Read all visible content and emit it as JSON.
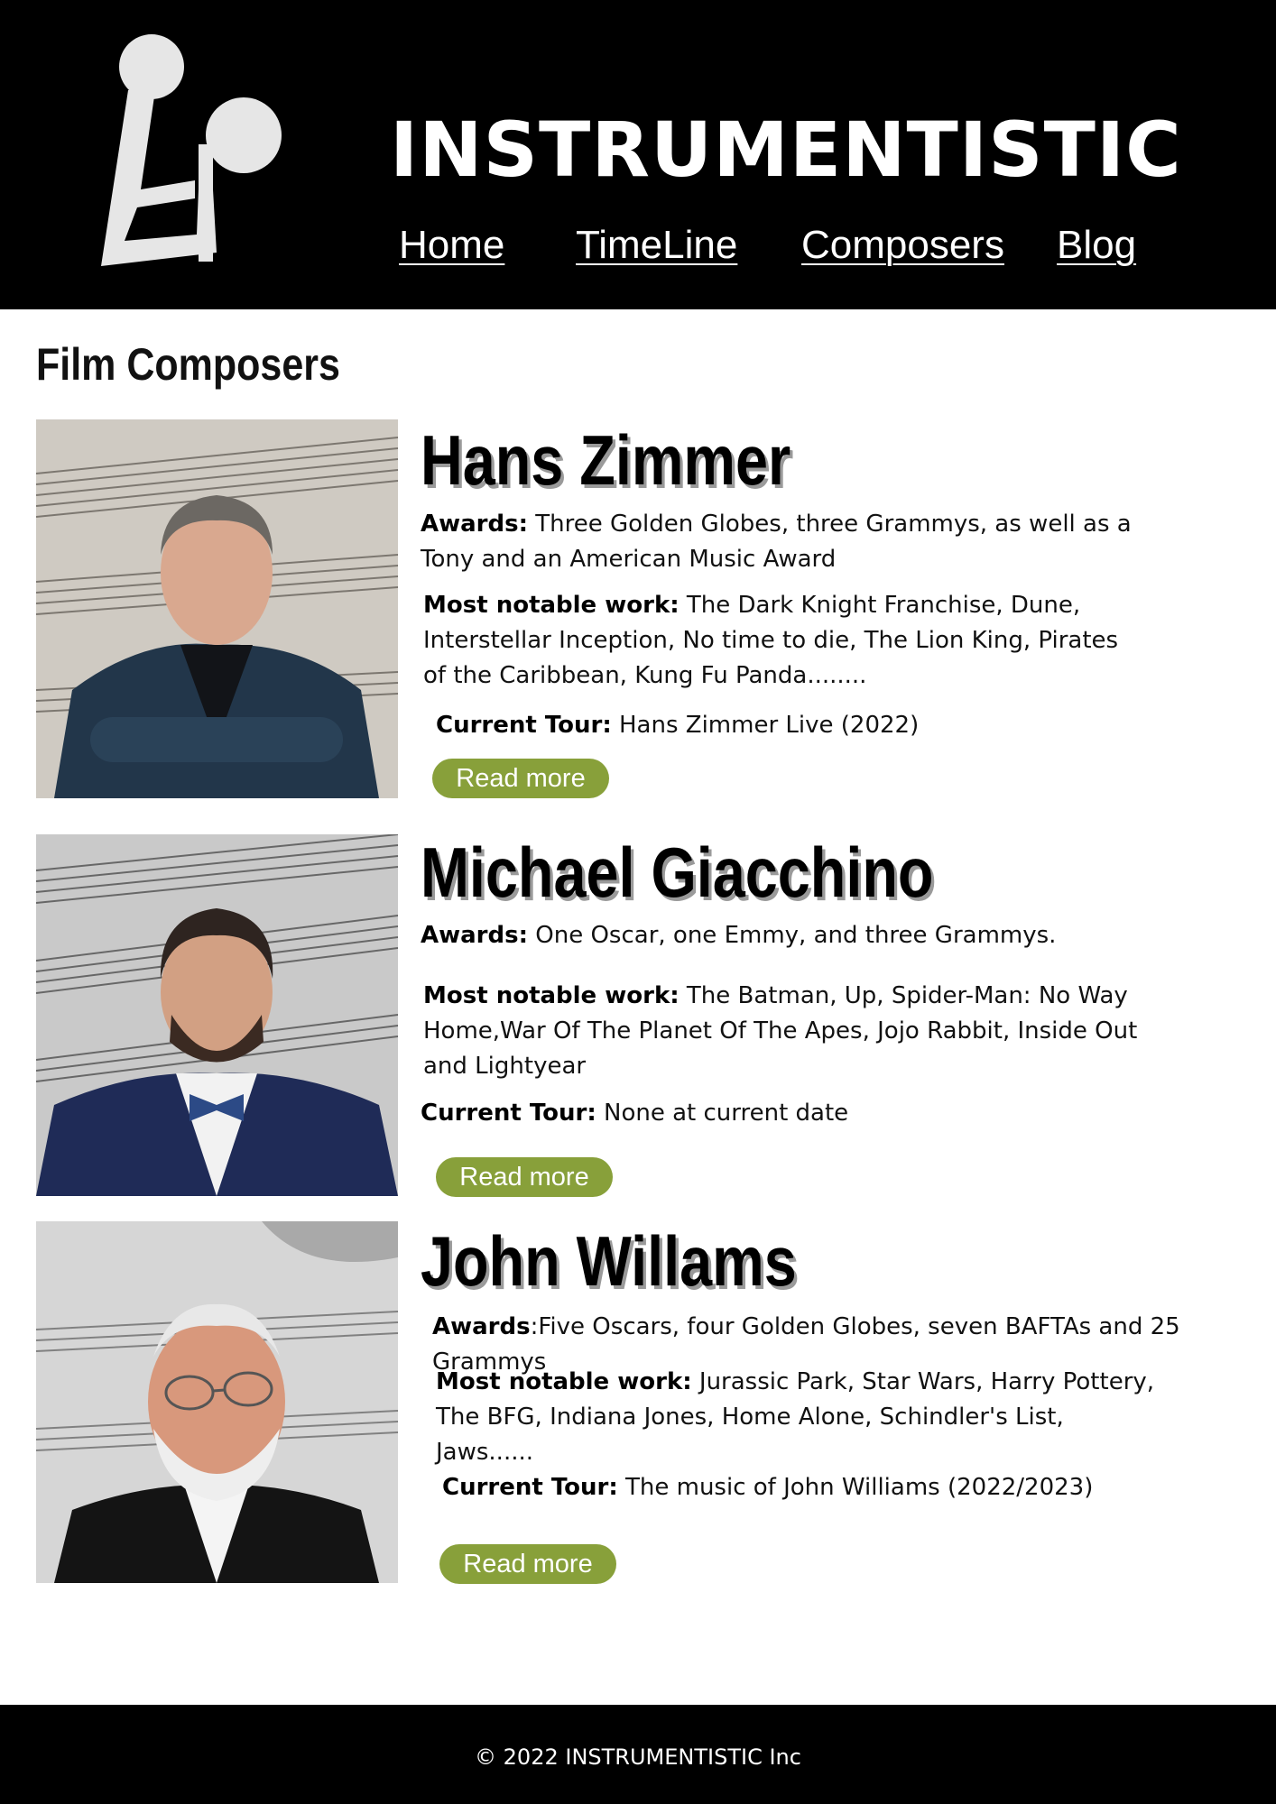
{
  "site": {
    "title": "INSTRUMENTISTIC"
  },
  "nav": {
    "home": "Home",
    "timeline": "TimeLine",
    "composers": "Composers",
    "blog": "Blog"
  },
  "page": {
    "section_title": "Film Composers"
  },
  "composers": [
    {
      "name": "Hans Zimmer",
      "awards_label": "Awards:",
      "awards": " Three Golden Globes, three Grammys, as well as a Tony and an American Music Award",
      "work_label": "Most notable work:",
      "work": " The Dark Knight Franchise, Dune,  Interstellar Inception, No time to die, The Lion King, Pirates of the Caribbean, Kung Fu Panda........",
      "tour_label": "Current Tour:",
      "tour": " Hans Zimmer Live (2022)",
      "button": "Read more"
    },
    {
      "name": "Michael Giacchino",
      "awards_label": "Awards:",
      "awards": " One Oscar, one Emmy, and three Grammys.",
      "work_label": "Most notable work:",
      "work": " The Batman, Up, Spider-Man: No Way Home,War Of The Planet Of The Apes,  Jojo Rabbit, Inside Out and Lightyear",
      "tour_label": "Current Tour:",
      "tour": " None at current date",
      "button": "Read more"
    },
    {
      "name": "John Willams",
      "awards_label": "Awards",
      "awards": ":Five Oscars, four Golden Globes, seven BAFTAs and 25 Grammys",
      "work_label": "Most notable work:",
      "work": " Jurassic Park, Star Wars, Harry Pottery, The BFG, Indiana Jones, Home Alone, Schindler's List,  Jaws......",
      "tour_label": "Current Tour:",
      "tour": " The music of John Williams (2022/2023)",
      "button": "Read more"
    }
  ],
  "footer": {
    "copyright": "© 2022 INSTRUMENTISTIC Inc"
  },
  "colors": {
    "header_bg": "#000000",
    "button_bg": "#88a03a",
    "footer_bg": "#000000"
  }
}
